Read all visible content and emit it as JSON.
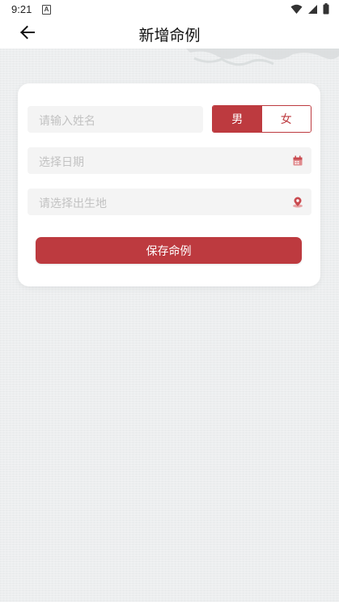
{
  "status_bar": {
    "time": "9:21",
    "notification_glyph": "A",
    "icons": [
      "wifi-icon",
      "signal-icon",
      "battery-icon"
    ]
  },
  "header": {
    "title": "新增命例",
    "back_icon": "arrow-left-icon"
  },
  "form": {
    "name_placeholder": "请输入姓名",
    "gender": {
      "male": "男",
      "female": "女",
      "selected": "男"
    },
    "date_placeholder": "选择日期",
    "date_icon": "calendar-icon",
    "place_placeholder": "请选择出生地",
    "place_icon": "location-pin-icon",
    "save_label": "保存命例"
  },
  "colors": {
    "accent": "#bd3a3f",
    "background": "#eceeef",
    "card": "#ffffff",
    "field": "#f4f4f4",
    "placeholder": "#c2c2c2"
  }
}
